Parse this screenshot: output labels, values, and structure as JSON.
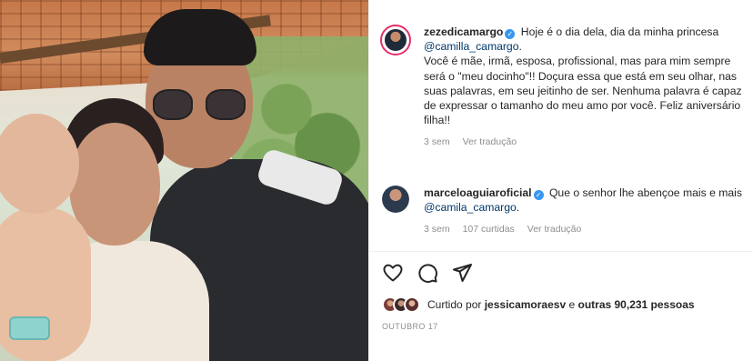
{
  "post": {
    "comments": [
      {
        "username": "zezedicamargo",
        "verified": true,
        "line1": "Hoje é o dia dela, dia da minha princesa",
        "mention": "@camilla_camargo",
        "after_mention": ".",
        "body": "Você é mãe, irmã, esposa, profissional, mas para mim sempre será o \"meu docinho\"!! Doçura essa que está em seu olhar, nas suas palavras, em seu jeitinho de ser. Nenhuma palavra é capaz de expressar o tamanho do meu amo por você. Feliz aniversário filha!!",
        "time": "3 sem",
        "translate": "Ver tradução"
      },
      {
        "username": "marceloaguiaroficial",
        "verified": true,
        "line1": "Que o senhor lhe abençoe mais e mais",
        "mention": "@camila_camargo",
        "after_mention": ".",
        "time": "3 sem",
        "likes": "107 curtidas",
        "translate": "Ver tradução"
      }
    ],
    "actions": {
      "like_icon": "heart-icon",
      "comment_icon": "comment-icon",
      "share_icon": "send-icon"
    },
    "likes": {
      "prefix": "Curtido por",
      "user": "jessicamoraesv",
      "connector": "e",
      "others": "outras 90,231 pessoas"
    },
    "date": "OUTUBRO 17",
    "colors": {
      "verified": "#3897f0",
      "mention": "#00376b",
      "meta": "#8e8e8e",
      "story_ring": "#e1306c"
    }
  }
}
